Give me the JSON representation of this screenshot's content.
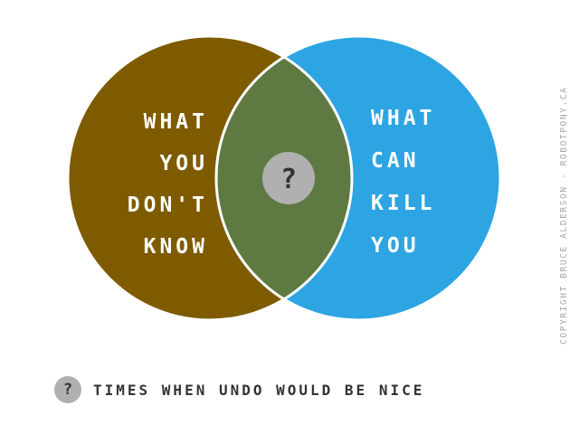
{
  "colors": {
    "left_circle": "#7f5b00",
    "right_circle": "#2da5e3",
    "intersection": "#5e7a42",
    "outline": "#ffffff",
    "badge": "#b0b0b0",
    "badge_text": "#333333"
  },
  "left_set": {
    "lines": [
      "WHAT",
      "YOU",
      "DON'T",
      "KNOW"
    ]
  },
  "right_set": {
    "lines": [
      "WHAT",
      "CAN",
      "KILL",
      "YOU"
    ]
  },
  "intersection": {
    "symbol": "?",
    "icon": "question-mark-icon"
  },
  "legend": {
    "symbol": "?",
    "icon": "question-mark-icon",
    "text": "TIMES WHEN UNDO WOULD BE NICE"
  },
  "copyright": "COPYRIGHT BRUCE ALDERSON - ROBOTPONY.CA"
}
